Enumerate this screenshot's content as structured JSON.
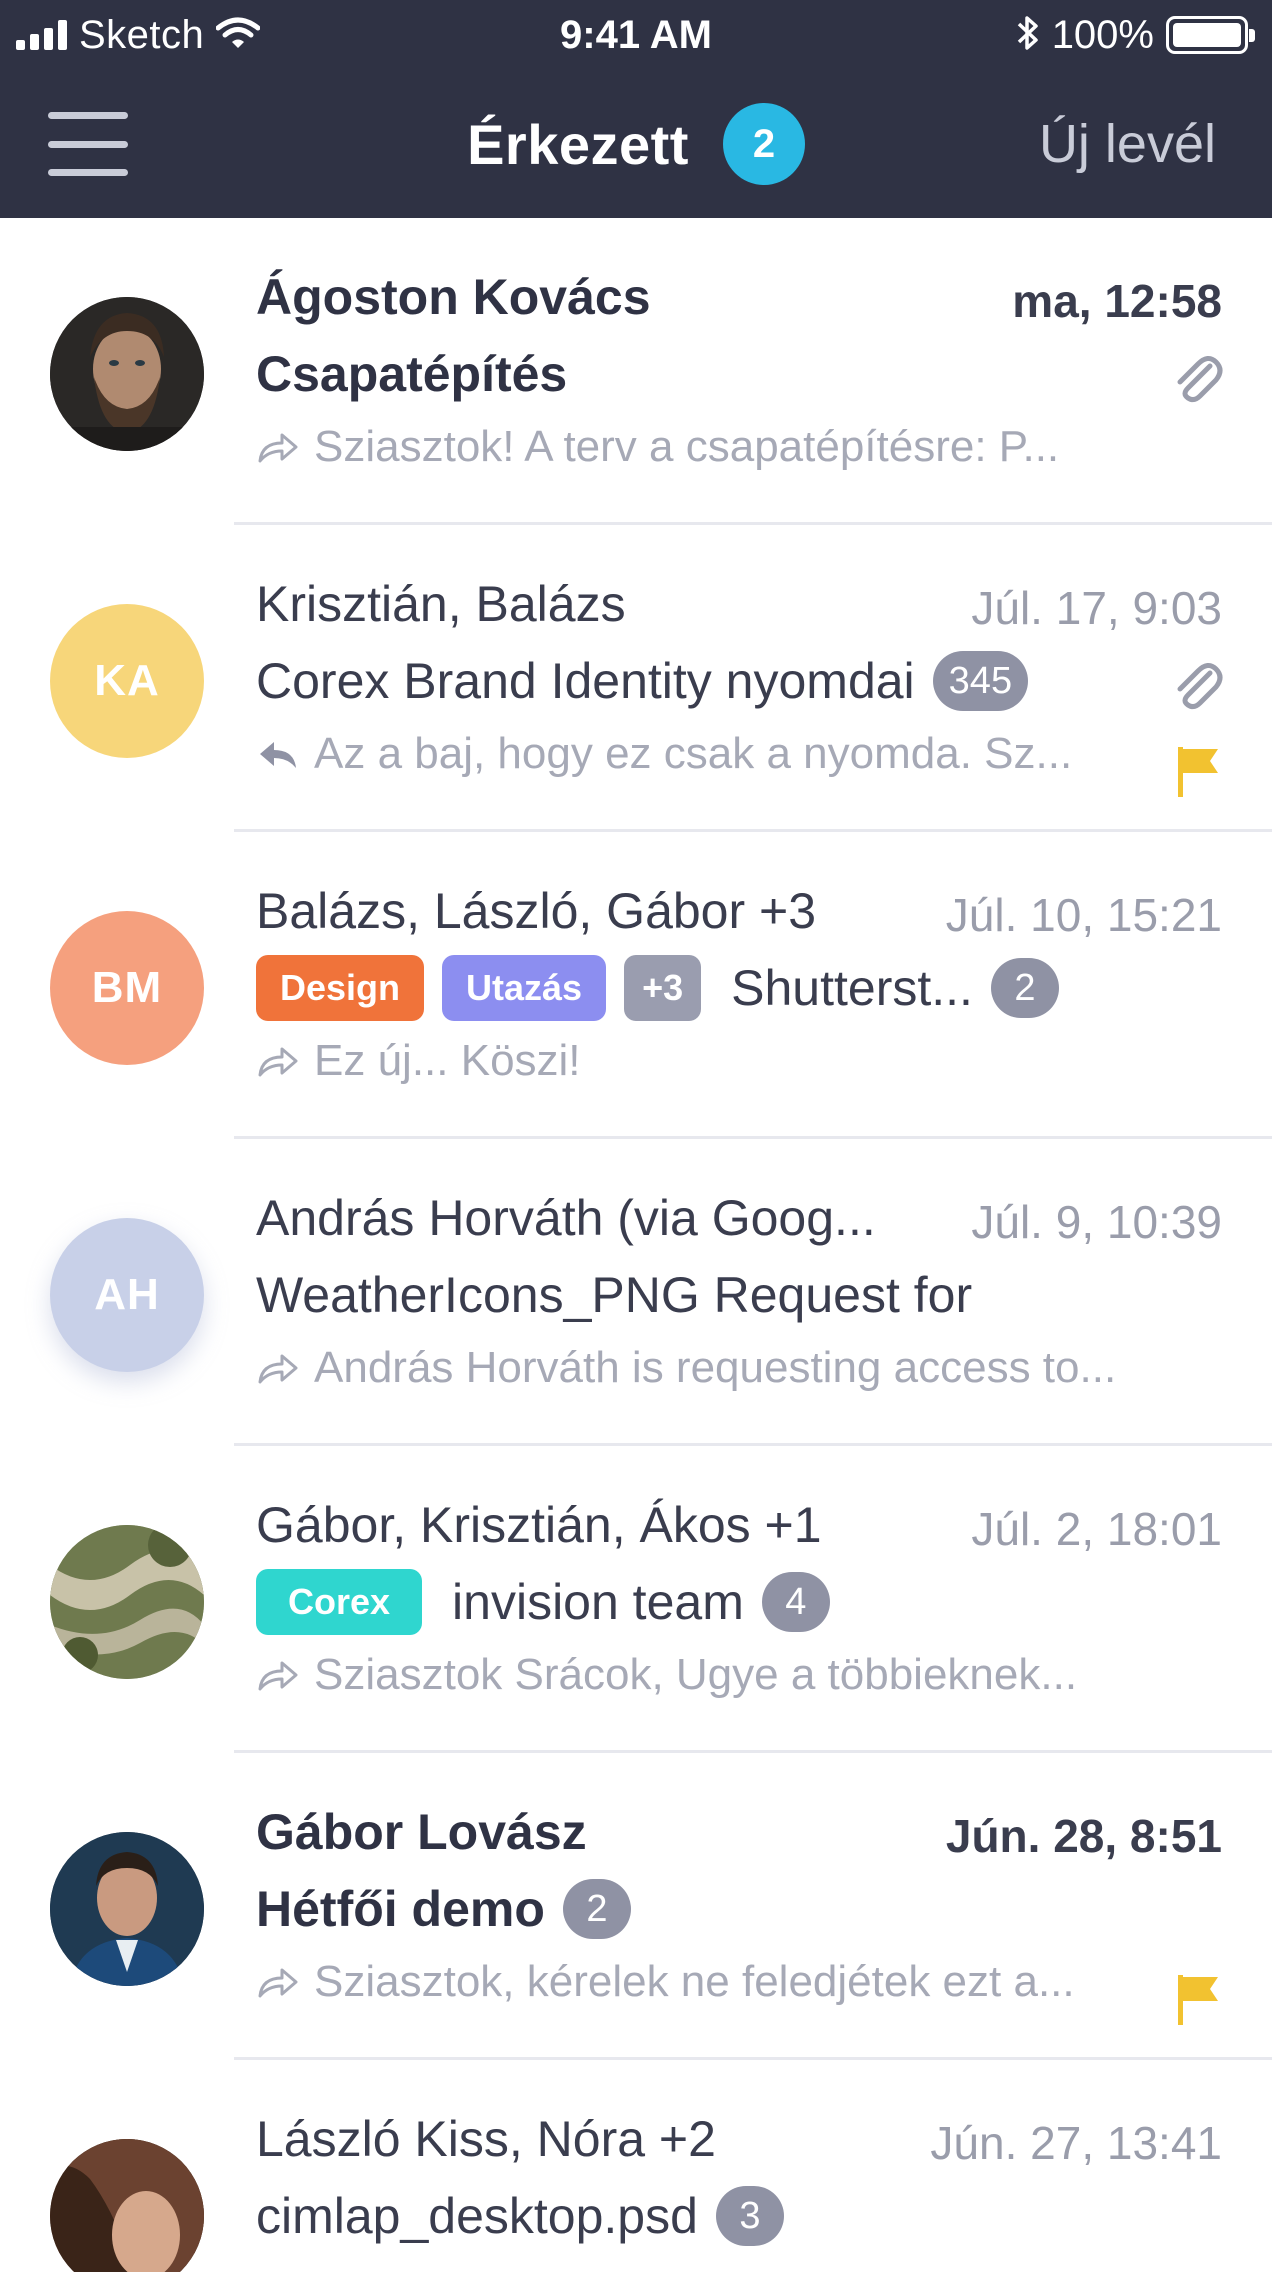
{
  "status_bar": {
    "carrier": "Sketch",
    "time": "9:41 AM",
    "battery": "100%",
    "icons": [
      "signal-icon",
      "wifi-icon",
      "bluetooth-icon",
      "battery-icon"
    ]
  },
  "nav": {
    "title": "Érkezett",
    "unread_badge": "2",
    "compose_label": "Új levél",
    "colors": {
      "header_bg": "#2f3244",
      "badge": "#29b8e3"
    }
  },
  "emails": [
    {
      "from": "Ágoston Kovács",
      "date": "ma, 12:58",
      "subject": "Csapatépítés",
      "preview": "Sziasztok! A terv a csapatépítésre: P...",
      "preview_icon": "forward-icon",
      "unread": true,
      "attachment": true
    },
    {
      "from": "Krisztián, Balázs",
      "date": "Júl. 17, 9:03",
      "avatar_initials": "KA",
      "avatar_color": "#f7d67a",
      "subject": "Corex Brand Identity nyomdai",
      "count": "345",
      "preview": "Az a baj, hogy ez csak a nyomda. Sz...",
      "preview_icon": "reply-icon",
      "attachment": true,
      "flagged": true
    },
    {
      "from": "Balázs, László, Gábor +3",
      "date": "Júl. 10, 15:21",
      "avatar_initials": "BM",
      "avatar_color": "#f5a07e",
      "tags": [
        {
          "label": "Design",
          "color": "#f0733a"
        },
        {
          "label": "Utazás",
          "color": "#8c8ef0"
        },
        {
          "label": "+3",
          "color": "#9a9daf"
        }
      ],
      "subject": "Shutterst...",
      "count": "2",
      "preview": "Ez új... Köszi!",
      "preview_icon": "forward-icon"
    },
    {
      "from": "András Horváth (via Goog...",
      "date": "Júl. 9, 10:39",
      "avatar_initials": "AH",
      "avatar_color": "#c8d0e8",
      "subject": "WeatherIcons_PNG Request for",
      "preview": "András Horváth is requesting access to...",
      "preview_icon": "forward-icon"
    },
    {
      "from": "Gábor, Krisztián, Ákos +1",
      "date": "Júl. 2, 18:01",
      "tags": [
        {
          "label": "Corex",
          "color": "#2fd6cf"
        }
      ],
      "subject": "invision team",
      "count": "4",
      "preview": "Sziasztok Srácok, Ugye a többieknek...",
      "preview_icon": "forward-icon"
    },
    {
      "from": "Gábor Lovász",
      "date": "Jún. 28, 8:51",
      "subject": "Hétfői demo",
      "count": "2",
      "preview": "Sziasztok, kérelek ne feledjétek ezt a...",
      "preview_icon": "forward-icon",
      "unread": true,
      "flagged": true
    },
    {
      "from": "László Kiss, Nóra +2",
      "date": "Jún. 27, 13:41",
      "subject": "cimlap_desktop.psd",
      "count": "3"
    }
  ]
}
